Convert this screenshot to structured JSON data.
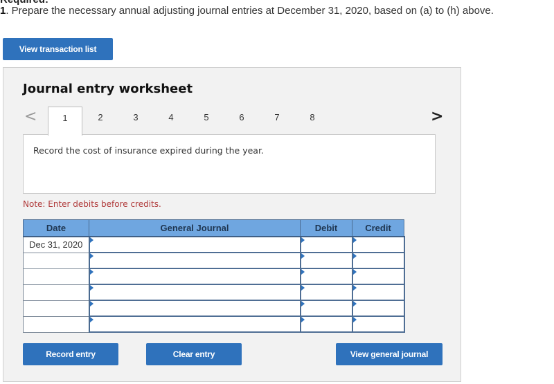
{
  "required_heading": "Required:",
  "question": {
    "number": "1",
    "text": ". Prepare the necessary annual adjusting journal entries at December 31, 2020, based on (a) to (h) above."
  },
  "buttons": {
    "view_transaction_list": "View transaction list",
    "record_entry": "Record entry",
    "clear_entry": "Clear entry",
    "view_general_journal": "View general journal"
  },
  "worksheet": {
    "title": "Journal entry worksheet",
    "nav_prev_icon": "chevron-left-icon",
    "nav_next_icon": "chevron-right-icon",
    "prev_glyph": "<",
    "next_glyph": ">",
    "tabs": [
      "1",
      "2",
      "3",
      "4",
      "5",
      "6",
      "7",
      "8"
    ],
    "active_tab": "1",
    "instruction": "Record the cost of insurance expired during the year.",
    "note": "Note: Enter debits before credits."
  },
  "journal_table": {
    "headers": [
      "Date",
      "General Journal",
      "Debit",
      "Credit"
    ],
    "rows": [
      {
        "date": "Dec 31, 2020",
        "account": "",
        "debit": "",
        "credit": ""
      },
      {
        "date": "",
        "account": "",
        "debit": "",
        "credit": ""
      },
      {
        "date": "",
        "account": "",
        "debit": "",
        "credit": ""
      },
      {
        "date": "",
        "account": "",
        "debit": "",
        "credit": ""
      },
      {
        "date": "",
        "account": "",
        "debit": "",
        "credit": ""
      },
      {
        "date": "",
        "account": "",
        "debit": "",
        "credit": ""
      }
    ]
  },
  "colors": {
    "button_blue": "#2f72bc",
    "header_blue": "#6fa6e0",
    "note_red": "#b03a3a",
    "panel_gray": "#f2f2f2"
  }
}
